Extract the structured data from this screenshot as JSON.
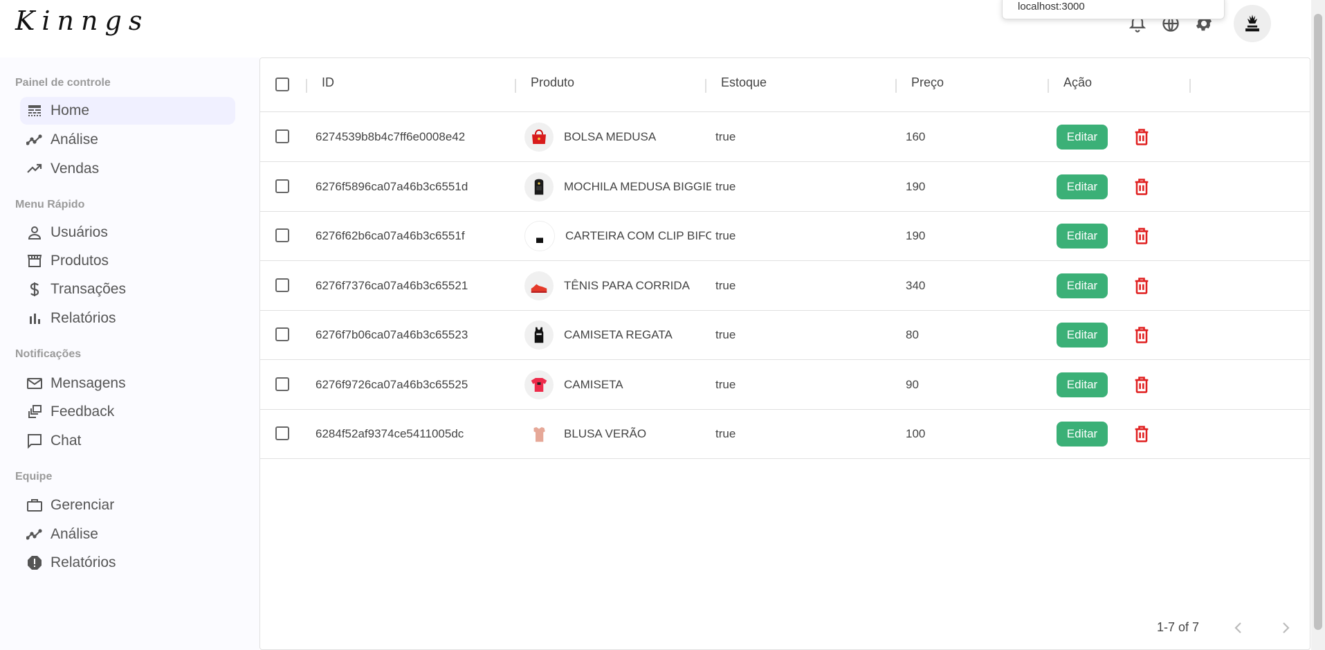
{
  "app": {
    "logo": "Kinngs"
  },
  "popup": {
    "text": "localhost:3000"
  },
  "topbar": {
    "icons": [
      "bell-icon",
      "globe-icon",
      "gear-icon",
      "avatar"
    ]
  },
  "sidebar": {
    "sections": [
      {
        "title": "Painel de controle",
        "items": [
          {
            "label": "Home",
            "icon": "line-style-icon",
            "active": true
          },
          {
            "label": "Análise",
            "icon": "timeline-icon"
          },
          {
            "label": "Vendas",
            "icon": "trending-up-icon"
          }
        ]
      },
      {
        "title": "Menu Rápido",
        "items": [
          {
            "label": "Usuários",
            "icon": "person-outline-icon"
          },
          {
            "label": "Produtos",
            "icon": "storefront-icon"
          },
          {
            "label": "Transações",
            "icon": "dollar-icon"
          },
          {
            "label": "Relatórios",
            "icon": "bar-chart-icon"
          }
        ]
      },
      {
        "title": "Notificações",
        "items": [
          {
            "label": "Mensagens",
            "icon": "mail-outline-icon"
          },
          {
            "label": "Feedback",
            "icon": "dynamic-feed-icon"
          },
          {
            "label": "Chat",
            "icon": "chat-bubble-outline-icon"
          }
        ]
      },
      {
        "title": "Equipe",
        "items": [
          {
            "label": "Gerenciar",
            "icon": "work-outline-icon"
          },
          {
            "label": "Análise",
            "icon": "timeline-icon"
          },
          {
            "label": "Relatórios",
            "icon": "report-icon"
          }
        ]
      }
    ]
  },
  "table": {
    "columns": [
      "ID",
      "Produto",
      "Estoque",
      "Preço",
      "Ação"
    ],
    "rows": [
      {
        "id": "6274539b8b4c7ff6e0008e42",
        "produto": "BOLSA MEDUSA",
        "estoque": "true",
        "preco": "160",
        "thumb": "red-bag"
      },
      {
        "id": "6276f5896ca07a46b3c6551d",
        "produto": "MOCHILA MEDUSA BIGGIE",
        "estoque": "true",
        "preco": "190",
        "thumb": "black-backpack"
      },
      {
        "id": "6276f62b6ca07a46b3c6551f",
        "produto": "CARTEIRA COM CLIP BIFOLD",
        "estoque": "true",
        "preco": "190",
        "thumb": "black-wallet"
      },
      {
        "id": "6276f7376ca07a46b3c65521",
        "produto": "TÊNIS PARA CORRIDA",
        "estoque": "true",
        "preco": "340",
        "thumb": "red-shoe"
      },
      {
        "id": "6276f7b06ca07a46b3c65523",
        "produto": "CAMISETA REGATA",
        "estoque": "true",
        "preco": "80",
        "thumb": "black-tank"
      },
      {
        "id": "6276f9726ca07a46b3c65525",
        "produto": "CAMISETA",
        "estoque": "true",
        "preco": "90",
        "thumb": "red-tshirt"
      },
      {
        "id": "6284f52af9374ce5411005dc",
        "produto": "BLUSA VERÃO",
        "estoque": "true",
        "preco": "100",
        "thumb": "pink-blouse"
      }
    ],
    "edit_label": "Editar"
  },
  "pagination": {
    "text": "1-7 of 7"
  },
  "colors": {
    "edit_button": "#3bb077",
    "delete_icon": "#e02020",
    "active_nav": "#f0f0ff"
  }
}
